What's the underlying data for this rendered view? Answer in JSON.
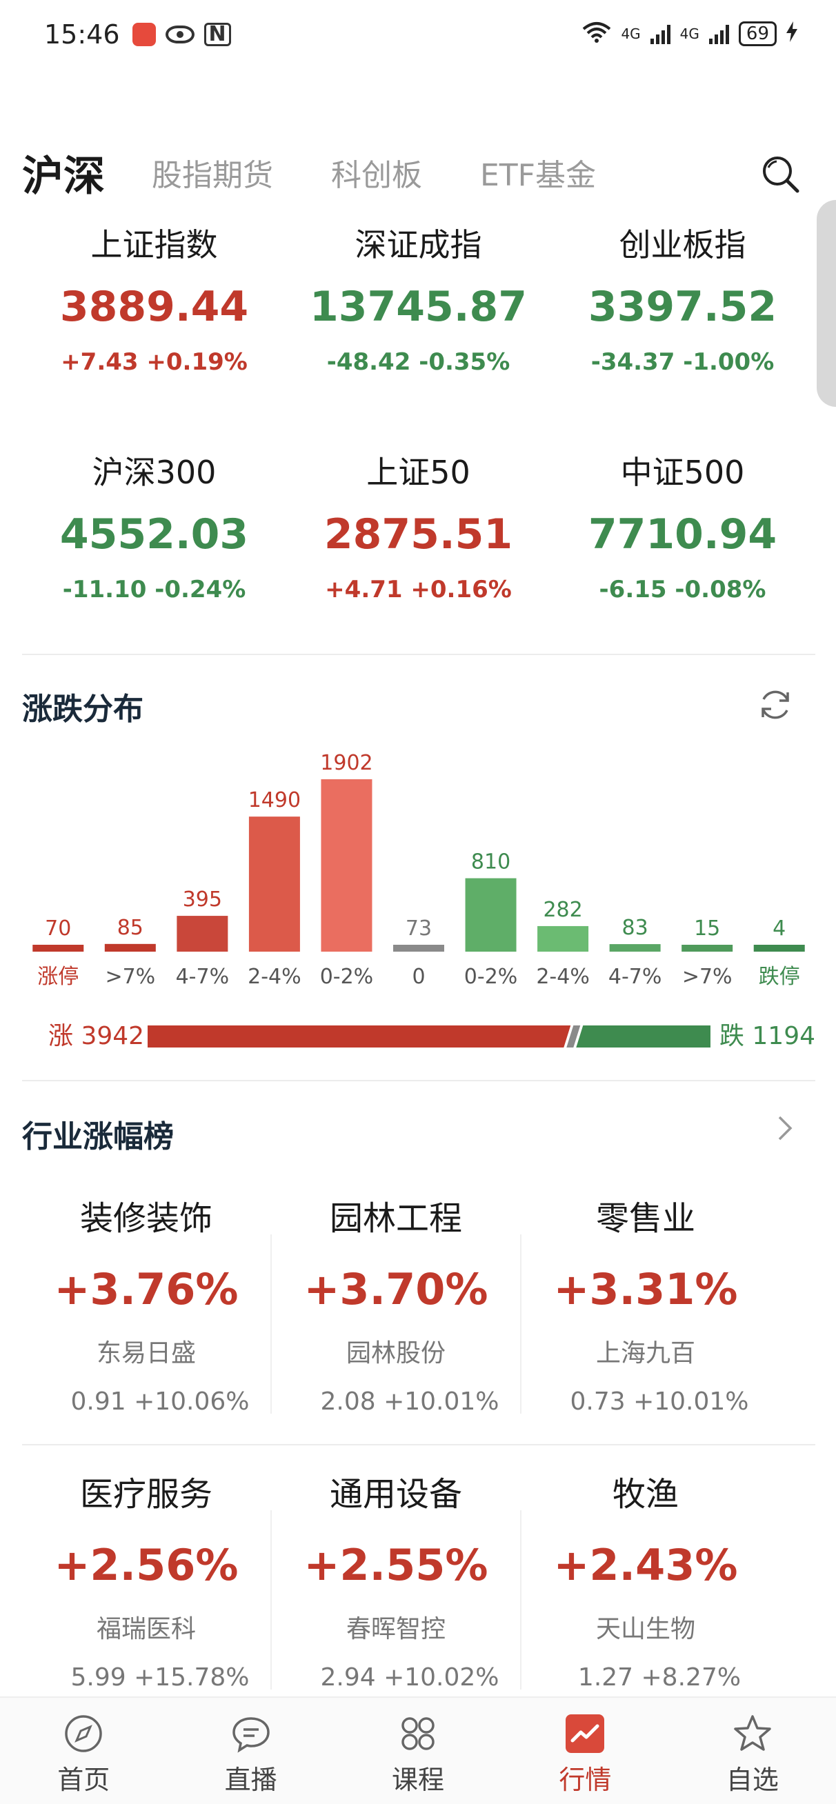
{
  "status": {
    "time": "15:46",
    "network_1": "6",
    "network_2": "4G",
    "network_3": "4G",
    "battery": "69"
  },
  "tabs": [
    {
      "label": "沪深",
      "active": true
    },
    {
      "label": "股指期货",
      "active": false
    },
    {
      "label": "科创板",
      "active": false
    },
    {
      "label": "ETF基金",
      "active": false
    }
  ],
  "indices": [
    {
      "name": "上证指数",
      "value": "3889.44",
      "change": "+7.43  +0.19%",
      "dir": "up"
    },
    {
      "name": "深证成指",
      "value": "13745.87",
      "change": "-48.42  -0.35%",
      "dir": "down"
    },
    {
      "name": "创业板指",
      "value": "3397.52",
      "change": "-34.37  -1.00%",
      "dir": "down"
    },
    {
      "name": "沪深300",
      "value": "4552.03",
      "change": "-11.10  -0.24%",
      "dir": "down"
    },
    {
      "name": "上证50",
      "value": "2875.51",
      "change": "+4.71  +0.16%",
      "dir": "up"
    },
    {
      "name": "中证500",
      "value": "7710.94",
      "change": "-6.15  -0.08%",
      "dir": "down"
    }
  ],
  "distribution": {
    "title": "涨跌分布",
    "up_label": "涨 3942",
    "down_label": "跌 1194",
    "up_count": 3942,
    "down_count": 1194
  },
  "chart_data": {
    "type": "bar",
    "categories": [
      "涨停",
      ">7%",
      "4-7%",
      "2-4%",
      "0-2%",
      "0",
      "0-2%",
      "2-4%",
      "4-7%",
      ">7%",
      "跌停"
    ],
    "values": [
      70,
      85,
      395,
      1490,
      1902,
      73,
      810,
      282,
      83,
      15,
      4
    ],
    "colors": [
      "#c0392b",
      "#c0392b",
      "#c9473a",
      "#dc5a4a",
      "#ea6e60",
      "#8a8a8a",
      "#5fae68",
      "#6bbb72",
      "#5aa665",
      "#4f9a5b",
      "#3e8b4f"
    ],
    "label_colors": [
      "#c0392b",
      "#c0392b",
      "#c0392b",
      "#c0392b",
      "#c0392b",
      "#777777",
      "#3e8b4f",
      "#3e8b4f",
      "#3e8b4f",
      "#3e8b4f",
      "#3e8b4f"
    ],
    "ylim": [
      0,
      1902
    ]
  },
  "industry": {
    "title": "行业涨幅榜",
    "items": [
      {
        "name": "装修装饰",
        "change": "+3.76%",
        "stock": "东易日盛",
        "detail": "0.91  +10.06%"
      },
      {
        "name": "园林工程",
        "change": "+3.70%",
        "stock": "园林股份",
        "detail": "2.08  +10.01%"
      },
      {
        "name": "零售业",
        "change": "+3.31%",
        "stock": "上海九百",
        "detail": "0.73  +10.01%"
      },
      {
        "name": "医疗服务",
        "change": "+2.56%",
        "stock": "福瑞医科",
        "detail": "5.99  +15.78%"
      },
      {
        "name": "通用设备",
        "change": "+2.55%",
        "stock": "春晖智控",
        "detail": "2.94  +10.02%"
      },
      {
        "name": "牧渔",
        "change": "+2.43%",
        "stock": "天山生物",
        "detail": "1.27  +8.27%"
      }
    ]
  },
  "nav": [
    {
      "label": "首页",
      "icon": "compass-icon",
      "active": false
    },
    {
      "label": "直播",
      "icon": "chat-bubble-icon",
      "active": false
    },
    {
      "label": "课程",
      "icon": "grid-icon",
      "active": false
    },
    {
      "label": "行情",
      "icon": "chart-icon",
      "active": true
    },
    {
      "label": "自选",
      "icon": "star-icon",
      "active": false
    }
  ]
}
